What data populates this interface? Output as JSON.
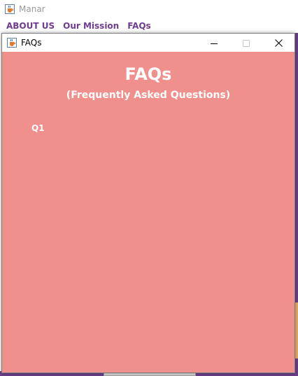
{
  "main_window": {
    "title": "Manar",
    "menu": [
      "ABOUT US",
      "Our Mission",
      "FAQs"
    ]
  },
  "dialog": {
    "title": "FAQs",
    "heading": "FAQs",
    "subheading": "(Frequently Asked Questions)",
    "questions": [
      "Q1"
    ]
  },
  "icons": {
    "app_icon": "java-coffee-cup-icon",
    "minimize": "minimize-icon",
    "maximize": "maximize-icon",
    "close": "close-icon"
  },
  "colors": {
    "dialog_background": "#ef908c",
    "menu_text": "#6f3c90",
    "heading_text": "#ffffff"
  }
}
